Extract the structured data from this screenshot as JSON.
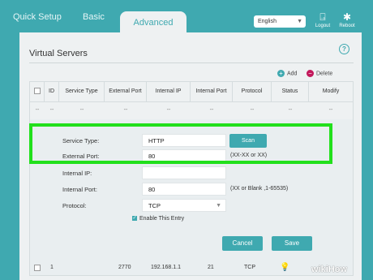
{
  "tabs": {
    "quick_setup": "Quick Setup",
    "basic": "Basic",
    "advanced": "Advanced"
  },
  "language": {
    "selected": "English"
  },
  "top_icons": {
    "logout": "Logout",
    "reboot": "Reboot"
  },
  "section": {
    "title": "Virtual Servers",
    "add": "Add",
    "delete": "Delete",
    "help": "?"
  },
  "table": {
    "headers": [
      "ID",
      "Service Type",
      "External Port",
      "Internal IP",
      "Internal Port",
      "Protocol",
      "Status",
      "Modify"
    ],
    "dash": "--",
    "row1": {
      "id": "1",
      "external_port": "2770",
      "internal_ip": "192.168.1.1",
      "internal_port": "21",
      "protocol": "TCP"
    }
  },
  "form": {
    "service_type_label": "Service Type:",
    "service_type_value": "HTTP",
    "scan_label": "Scan",
    "external_port_label": "External Port:",
    "external_port_value": "80",
    "external_port_hint": "(XX-XX or XX)",
    "internal_ip_label": "Internal IP:",
    "internal_ip_value": "",
    "internal_port_label": "Internal Port:",
    "internal_port_value": "80",
    "internal_port_hint": "(XX or Blank ,1-65535)",
    "protocol_label": "Protocol:",
    "protocol_value": "TCP",
    "enable_label": "Enable This Entry",
    "cancel_label": "Cancel",
    "save_label": "Save"
  },
  "colors": {
    "accent": "#3fa9b0",
    "highlight": "#22e01c",
    "delete": "#c2185b"
  },
  "watermark": "wikiHow"
}
